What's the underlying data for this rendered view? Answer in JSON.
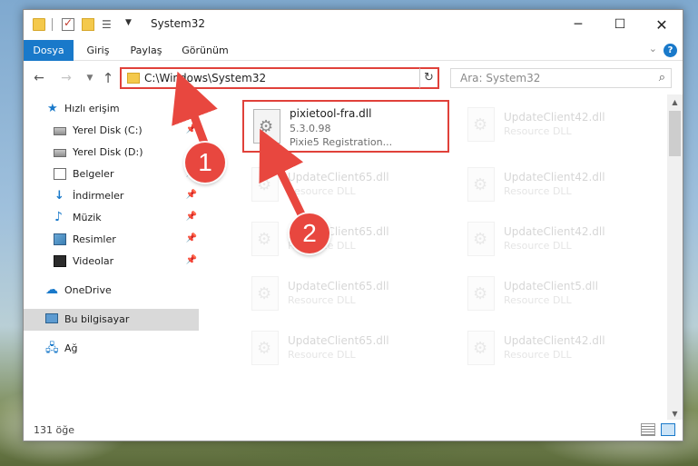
{
  "window": {
    "title": "System32"
  },
  "ribbon": {
    "tabs": [
      "Dosya",
      "Giriş",
      "Paylaş",
      "Görünüm"
    ]
  },
  "nav": {
    "address": "C:\\Windows\\System32",
    "search_placeholder": "Ara: System32"
  },
  "sidebar": {
    "items": [
      {
        "label": "Hızlı erişim",
        "icon": "star-icon",
        "pinned": false
      },
      {
        "label": "Yerel Disk (C:)",
        "icon": "drive-icon",
        "pinned": true
      },
      {
        "label": "Yerel Disk (D:)",
        "icon": "drive-icon",
        "pinned": false
      },
      {
        "label": "Belgeler",
        "icon": "documents-icon",
        "pinned": true
      },
      {
        "label": "İndirmeler",
        "icon": "download-icon",
        "pinned": true
      },
      {
        "label": "Müzik",
        "icon": "music-icon",
        "pinned": true
      },
      {
        "label": "Resimler",
        "icon": "pictures-icon",
        "pinned": true
      },
      {
        "label": "Videolar",
        "icon": "videos-icon",
        "pinned": true
      },
      {
        "label": "OneDrive",
        "icon": "onedrive-icon",
        "pinned": false
      },
      {
        "label": "Bu bilgisayar",
        "icon": "pc-icon",
        "pinned": false,
        "selected": true
      },
      {
        "label": "Ağ",
        "icon": "network-icon",
        "pinned": false
      }
    ]
  },
  "files": {
    "highlighted": {
      "name": "pixietool-fra.dll",
      "version": "5.3.0.98",
      "description": "Pixie5 Registration..."
    },
    "faded": [
      {
        "name": "UpdateClient42.dll",
        "description": "Resource DLL"
      },
      {
        "name": "UpdateClient65.dll",
        "description": "Resource DLL"
      },
      {
        "name": "UpdateClient42.dll",
        "description": "Resource DLL"
      },
      {
        "name": "UpdateClient65.dll",
        "description": "Resource DLL"
      },
      {
        "name": "UpdateClient42.dll",
        "description": "Resource DLL"
      },
      {
        "name": "UpdateClient65.dll",
        "description": "Resource DLL"
      },
      {
        "name": "UpdateClient5.dll",
        "description": "Resource DLL"
      },
      {
        "name": "UpdateClient65.dll",
        "description": "Resource DLL"
      },
      {
        "name": "UpdateClient42.dll",
        "description": "Resource DLL"
      }
    ]
  },
  "status": {
    "item_count": "131 öğe"
  },
  "callouts": [
    "1",
    "2"
  ],
  "colors": {
    "accent": "#1979ca",
    "highlight": "#e0413a",
    "callout": "#e8473f"
  }
}
